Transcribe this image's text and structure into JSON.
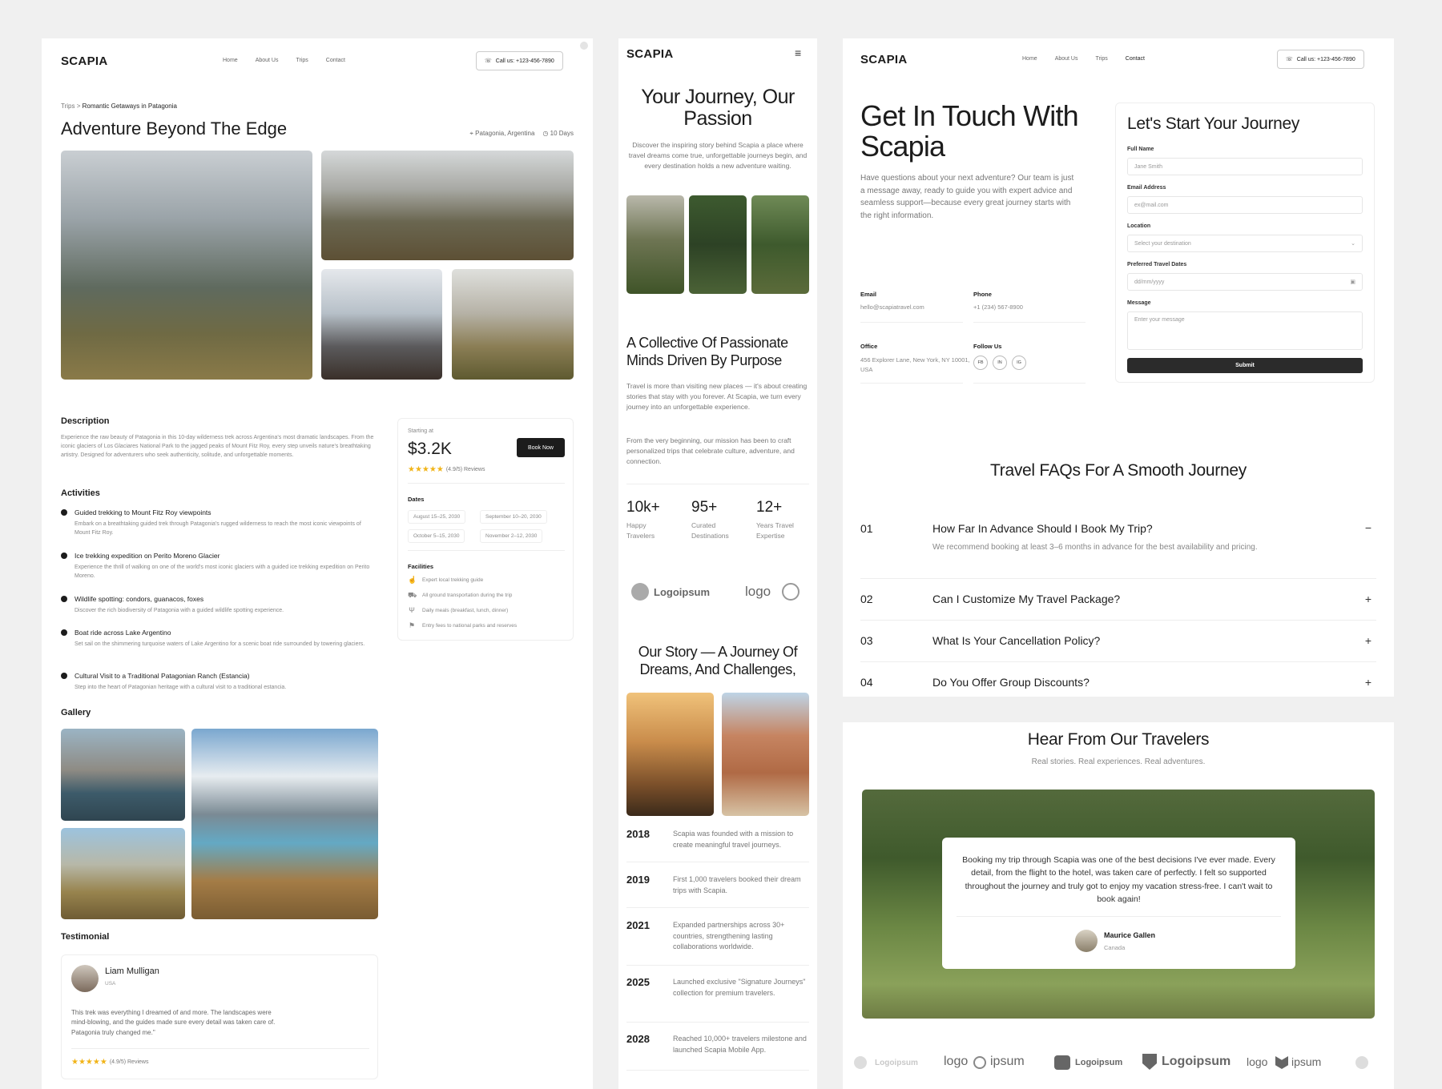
{
  "common": {
    "logo": "SCAPIA",
    "nav": [
      "Home",
      "About Us",
      "Trips",
      "Contact"
    ],
    "call": "Call us: +123-456-7890"
  },
  "detail": {
    "breadcrumb_parent": "Trips",
    "breadcrumb_sep": ">",
    "breadcrumb_current": "Romantic Getaways in Patagonia",
    "title": "Adventure Beyond The Edge",
    "location": "Patagonia, Argentina",
    "duration": "10 Days",
    "description_heading": "Description",
    "description": "Experience the raw beauty of Patagonia in this 10-day wilderness trek across Argentina's most dramatic landscapes. From the iconic glaciers of Los Glaciares National Park to the jagged peaks of Mount Fitz Roy, every step unveils nature's breathtaking artistry. Designed for adventurers who seek authenticity, solitude, and unforgettable moments.",
    "activities_heading": "Activities",
    "activities": [
      {
        "title": "Guided trekking to Mount Fitz Roy viewpoints",
        "text": "Embark on a breathtaking guided trek through Patagonia's rugged wilderness to reach the most iconic viewpoints of Mount Fitz Roy."
      },
      {
        "title": "Ice trekking expedition on Perito Moreno Glacier",
        "text": "Experience the thrill of walking on one of the world's most iconic glaciers with a guided ice trekking expedition on Perito Moreno."
      },
      {
        "title": "Wildlife spotting: condors, guanacos, foxes",
        "text": "Discover the rich biodiversity of Patagonia with a guided wildlife spotting experience."
      },
      {
        "title": "Boat ride across Lake Argentino",
        "text": "Set sail on the shimmering turquoise waters of Lake Argentino for a scenic boat ride surrounded by towering glaciers."
      },
      {
        "title": "Cultural Visit to a Traditional Patagonian Ranch (Estancia)",
        "text": "Step into the heart of Patagonian heritage with a cultural visit to a traditional estancia."
      }
    ],
    "gallery_heading": "Gallery",
    "testimonial_heading": "Testimonial",
    "testimonial": {
      "name": "Liam Mulligan",
      "country": "USA",
      "text": "This trek was everything I dreamed of and more. The landscapes were mind-blowing, and the guides made sure every detail was taken care of. Patagonia truly changed me.\"",
      "rating": "(4.9/5) Reviews"
    },
    "booking": {
      "starting_label": "Starting at",
      "price": "$3.2K",
      "book_button": "Book Now",
      "rating": "(4.9/5) Reviews",
      "dates_heading": "Dates",
      "dates": [
        "August 15–25, 2030",
        "September 10–20, 2030",
        "October 5–15, 2030",
        "November 2–12, 2030"
      ],
      "facilities_heading": "Facilities",
      "facilities": [
        "Expert local trekking guide",
        "All ground transportation during the trip",
        "Daily meals (breakfast, lunch, dinner)",
        "Entry fees to national parks and reserves"
      ]
    }
  },
  "about": {
    "hero_title": "Your Journey, Our Passion",
    "hero_text": "Discover the inspiring story behind Scapia a place where travel dreams come true, unforgettable journeys begin, and every destination holds a new adventure waiting.",
    "collective_title": "A Collective Of Passionate Minds Driven By Purpose",
    "collective_p1": "Travel is more than visiting new places — it's about creating stories that stay with you forever. At Scapia, we turn every journey into an unforgettable experience.",
    "collective_p2": "From the very beginning, our mission has been to craft personalized trips that celebrate culture, adventure, and connection.",
    "stats": [
      {
        "num": "10k+",
        "label": "Happy Travelers"
      },
      {
        "num": "95+",
        "label": "Curated Destinations"
      },
      {
        "num": "12+",
        "label": "Years Travel Expertise"
      }
    ],
    "brands": [
      "Logoipsum",
      "logo"
    ],
    "story_title": "Our Story — A Journey Of Dreams, And Challenges,",
    "timeline": [
      {
        "year": "2018",
        "text": "Scapia was founded with a mission to create meaningful travel journeys."
      },
      {
        "year": "2019",
        "text": "First 1,000 travelers booked their dream trips with Scapia."
      },
      {
        "year": "2021",
        "text": "Expanded partnerships across 30+ countries, strengthening lasting collaborations worldwide."
      },
      {
        "year": "2025",
        "text": "Launched exclusive \"Signature Journeys\" collection for premium travelers."
      },
      {
        "year": "2028",
        "text": "Reached 10,000+ travelers milestone and launched Scapia Mobile App."
      }
    ]
  },
  "contact": {
    "title": "Get In Touch With Scapia",
    "text": "Have questions about your next adventure? Our team is just a message away, ready to guide you with expert advice and seamless support—because every great journey starts with the right information.",
    "email_label": "Email",
    "email": "hello@scapiatravel.com",
    "phone_label": "Phone",
    "phone": "+1 (234) 567-8900",
    "office_label": "Office",
    "office": "456 Explorer Lane, New York, NY 10001, USA",
    "follow_label": "Follow Us",
    "socials": [
      "FB",
      "IN",
      "IG"
    ],
    "form": {
      "title": "Let's Start Your Journey",
      "name_label": "Full Name",
      "name_ph": "Jane Smith",
      "email_label": "Email Address",
      "email_ph": "ex@mail.com",
      "location_label": "Location",
      "location_ph": "Select your destination",
      "dates_label": "Preferred Travel Dates",
      "dates_ph": "dd/mm/yyyy",
      "message_label": "Message",
      "message_ph": "Enter your message",
      "submit": "Submit"
    },
    "faq_title": "Travel FAQs For A Smooth Journey",
    "faqs": [
      {
        "num": "01",
        "q": "How Far In Advance Should I Book My Trip?",
        "a": "We recommend booking at least 3–6 months in advance for the best availability and pricing.",
        "icon": "−"
      },
      {
        "num": "02",
        "q": "Can I Customize My Travel Package?",
        "icon": "+"
      },
      {
        "num": "03",
        "q": "What Is Your Cancellation Policy?",
        "icon": "+"
      },
      {
        "num": "04",
        "q": "Do You Offer Group Discounts?",
        "icon": "+"
      }
    ]
  },
  "testimonials": {
    "title": "Hear From Our Travelers",
    "subtitle": "Real stories. Real experiences. Real adventures.",
    "quote": "Booking my trip through Scapia was one of the best decisions I've ever made. Every detail, from the flight to the hotel, was taken care of perfectly. I felt so supported throughout the journey and truly got to enjoy my vacation stress-free. I can't wait to book again!",
    "name": "Maurice Gallen",
    "country": "Canada",
    "brands": [
      "Logoipsum",
      "logo",
      "ipsum",
      "Logoipsum",
      "Logoipsum",
      "logo",
      "ipsum"
    ]
  }
}
